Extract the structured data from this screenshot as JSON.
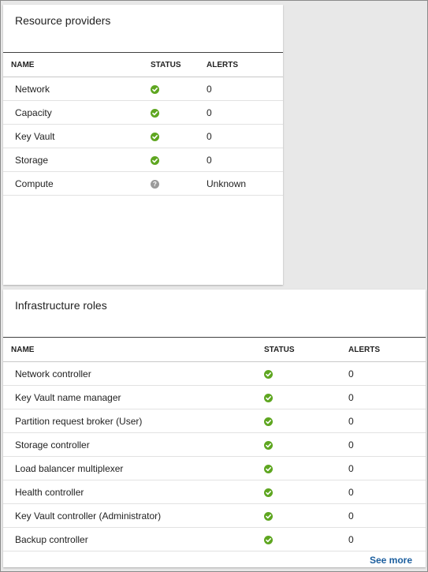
{
  "resource_providers": {
    "title": "Resource providers",
    "columns": [
      "NAME",
      "STATUS",
      "ALERTS"
    ],
    "rows": [
      {
        "name": "Network",
        "status": "ok",
        "alerts": "0"
      },
      {
        "name": "Capacity",
        "status": "ok",
        "alerts": "0"
      },
      {
        "name": "Key Vault",
        "status": "ok",
        "alerts": "0"
      },
      {
        "name": "Storage",
        "status": "ok",
        "alerts": "0"
      },
      {
        "name": "Compute",
        "status": "unknown",
        "alerts": "Unknown"
      }
    ]
  },
  "infrastructure_roles": {
    "title": "Infrastructure roles",
    "columns": [
      "NAME",
      "STATUS",
      "ALERTS"
    ],
    "rows": [
      {
        "name": "Network controller",
        "status": "ok",
        "alerts": "0"
      },
      {
        "name": "Key Vault name manager",
        "status": "ok",
        "alerts": "0"
      },
      {
        "name": "Partition request broker (User)",
        "status": "ok",
        "alerts": "0"
      },
      {
        "name": "Storage controller",
        "status": "ok",
        "alerts": "0"
      },
      {
        "name": "Load balancer multiplexer",
        "status": "ok",
        "alerts": "0"
      },
      {
        "name": "Health controller",
        "status": "ok",
        "alerts": "0"
      },
      {
        "name": "Key Vault controller (Administrator)",
        "status": "ok",
        "alerts": "0"
      },
      {
        "name": "Backup controller",
        "status": "ok",
        "alerts": "0"
      }
    ],
    "see_more_label": "See more"
  },
  "status_icons": {
    "ok": {
      "icon": "check-circle-icon",
      "color": "#5ea620"
    },
    "unknown": {
      "icon": "question-circle-icon",
      "color": "#9a9a9a",
      "glyph": "?"
    }
  }
}
